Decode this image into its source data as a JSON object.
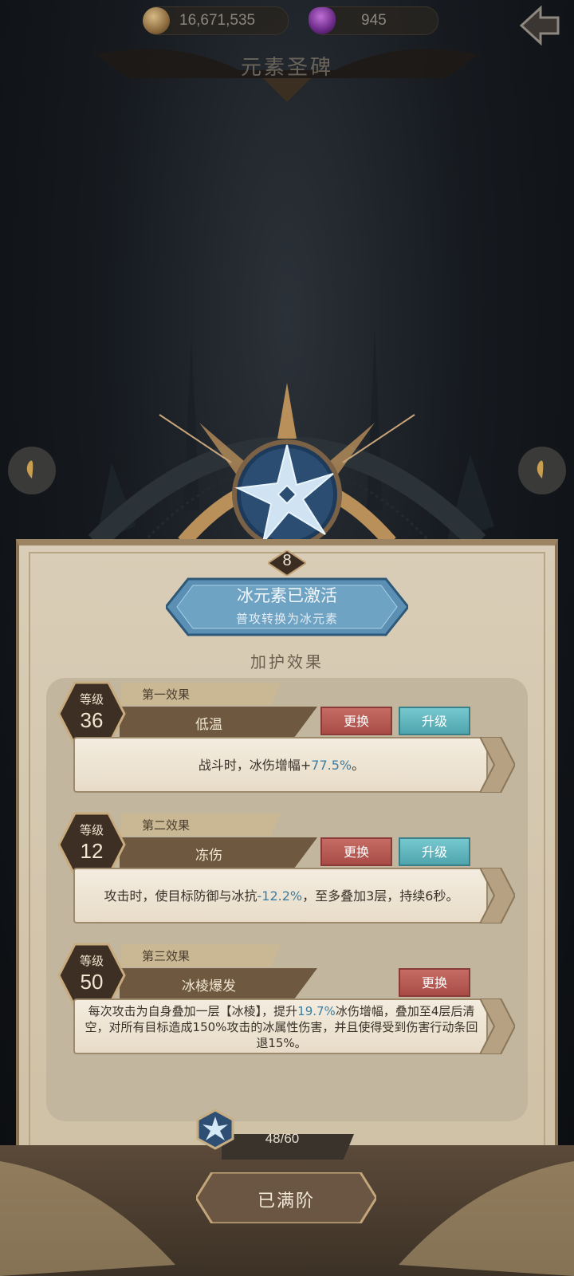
{
  "topbar": {
    "gold_amount": "16,671,535",
    "gem_amount": "945",
    "gold_icon": "coin-icon",
    "gem_icon": "crystal-icon",
    "back_icon": "back-arrow-icon"
  },
  "page_title": "元素圣碑",
  "monument": {
    "level": "8",
    "emblem_icon": "ice-star-icon"
  },
  "banner": {
    "title": "冰元素已激活",
    "subtitle": "普攻转换为冰元素"
  },
  "section_title": "加护效果",
  "effects": [
    {
      "level_label": "等级",
      "level": "36",
      "order_label": "第一效果",
      "name": "低温",
      "swap_label": "更换",
      "upgrade_label": "升级",
      "desc_pre": "战斗时，冰伤增幅+",
      "desc_hl": "77.5%",
      "desc_post": "。"
    },
    {
      "level_label": "等级",
      "level": "12",
      "order_label": "第二效果",
      "name": "冻伤",
      "swap_label": "更换",
      "upgrade_label": "升级",
      "desc_pre": "攻击时，使目标防御与冰抗",
      "desc_hl": "-12.2%",
      "desc_post": "，至多叠加3层，持续6秒。"
    },
    {
      "level_label": "等级",
      "level": "50",
      "order_label": "第三效果",
      "name": "冰棱爆发",
      "swap_label": "更换",
      "desc_pre": "每次攻击为自身叠加一层【冰棱】，提升",
      "desc_hl": "19.7%",
      "desc_post": "冰伤增幅，叠加至4层后清空，对所有目标造成150%攻击的冰属性伤害，并且使得受到伤害行动条回退15%。"
    }
  ],
  "progress": {
    "text": "48/60",
    "current": 48,
    "max": 60
  },
  "max_button_label": "已满阶",
  "colors": {
    "accent_blue": "#3b7ea1",
    "swap_red": "#b3534d",
    "upgrade_teal": "#5eb3bb"
  }
}
